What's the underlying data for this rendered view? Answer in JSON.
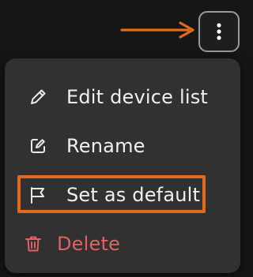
{
  "menu": {
    "items": [
      {
        "label": "Edit device list",
        "icon": "pencil-icon"
      },
      {
        "label": "Rename",
        "icon": "edit-square-icon"
      },
      {
        "label": "Set as default",
        "icon": "flag-icon"
      },
      {
        "label": "Delete",
        "icon": "trash-icon"
      }
    ]
  },
  "colors": {
    "background": "#161616",
    "menu_bg": "#313131",
    "text": "#f0f0f0",
    "danger": "#e06262",
    "annotation": "#e26a1e"
  }
}
